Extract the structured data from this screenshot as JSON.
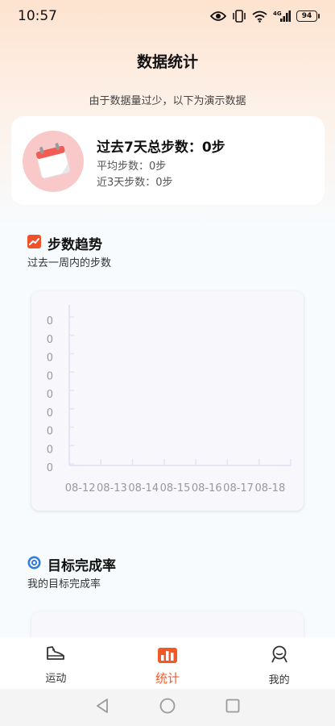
{
  "status_bar": {
    "time": "10:57",
    "battery": "94",
    "network_label": "4G"
  },
  "header": {
    "title": "数据统计",
    "demo_note": "由于数据量过少，以下为演示数据"
  },
  "summary": {
    "total_steps": "过去7天总步数：0步",
    "avg_steps": "平均步数：0步",
    "recent3_steps": "近3天步数：0步"
  },
  "trend_section": {
    "title": "步数趋势",
    "subtitle": "过去一周内的步数"
  },
  "chart_data": {
    "type": "line",
    "title": "",
    "xlabel": "",
    "ylabel": "",
    "categories": [
      "08-12",
      "08-13",
      "08-14",
      "08-15",
      "08-16",
      "08-17",
      "08-18"
    ],
    "y_tick_labels": [
      "0",
      "0",
      "0",
      "0",
      "0",
      "0",
      "0",
      "0",
      "0"
    ],
    "series": [
      {
        "values": [
          0,
          0,
          0,
          0,
          0,
          0,
          0
        ]
      }
    ],
    "grid": false,
    "colors": {
      "axis": "#e3e4f6",
      "tick_label": "#999999"
    }
  },
  "goal_section": {
    "title": "目标完成率",
    "subtitle": "我的目标完成率"
  },
  "tab_bar": {
    "items": [
      {
        "label": "运动",
        "icon": "shoe-icon"
      },
      {
        "label": "统计",
        "icon": "bar-chart-icon"
      },
      {
        "label": "我的",
        "icon": "profile-icon"
      }
    ],
    "active": "统计"
  },
  "colors": {
    "accent": "#f05a28",
    "trend_icon": "#f0502a",
    "goal_icon": "#2f7de1",
    "calendar_circle": "#f9c9c9"
  }
}
